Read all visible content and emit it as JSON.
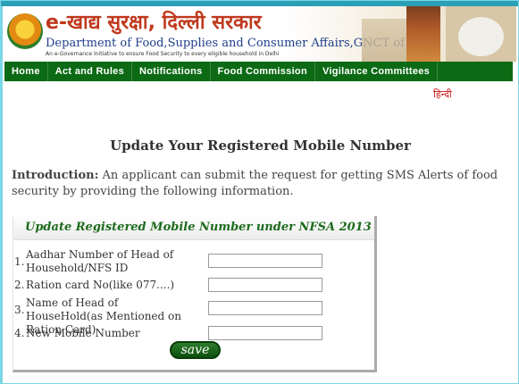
{
  "header": {
    "hindi_title": "e-खाद्य सुरक्षा, दिल्ली सरकार",
    "department": "Department of Food,Supplies and Consumer Affairs,GNCT of Delhi",
    "tagline": "An e-Governance Initiative to ensure Food Security to every eligible household in Delhi"
  },
  "nav": {
    "items": [
      {
        "label": "Home"
      },
      {
        "label": "Act and Rules"
      },
      {
        "label": "Notifications"
      },
      {
        "label": "Food Commission"
      },
      {
        "label": "Vigilance Committees"
      }
    ]
  },
  "language_link": "हिन्दी",
  "page": {
    "title": "Update Your Registered Mobile Number",
    "intro_label": "Introduction:",
    "intro_text": " An applicant can submit the request for getting SMS Alerts of food security by providing the following information."
  },
  "form": {
    "title": "Update Registered Mobile Number under NFSA 2013",
    "fields": [
      {
        "num": "1.",
        "label": "Aadhar Number of Head of Household/NFS ID",
        "value": ""
      },
      {
        "num": "2.",
        "label": "Ration card No(like 077....)",
        "value": ""
      },
      {
        "num": "3.",
        "label": "Name of Head of HouseHold(as Mentioned on Ration Card)",
        "value": ""
      },
      {
        "num": "4.",
        "label": "New Mobile Number",
        "value": ""
      }
    ],
    "save_label": "save"
  },
  "colors": {
    "nav_bg": "#0c6a15",
    "accent": "#2aa0b7",
    "title_red": "#c0391d",
    "panel_title_green": "#1d6b1d"
  }
}
